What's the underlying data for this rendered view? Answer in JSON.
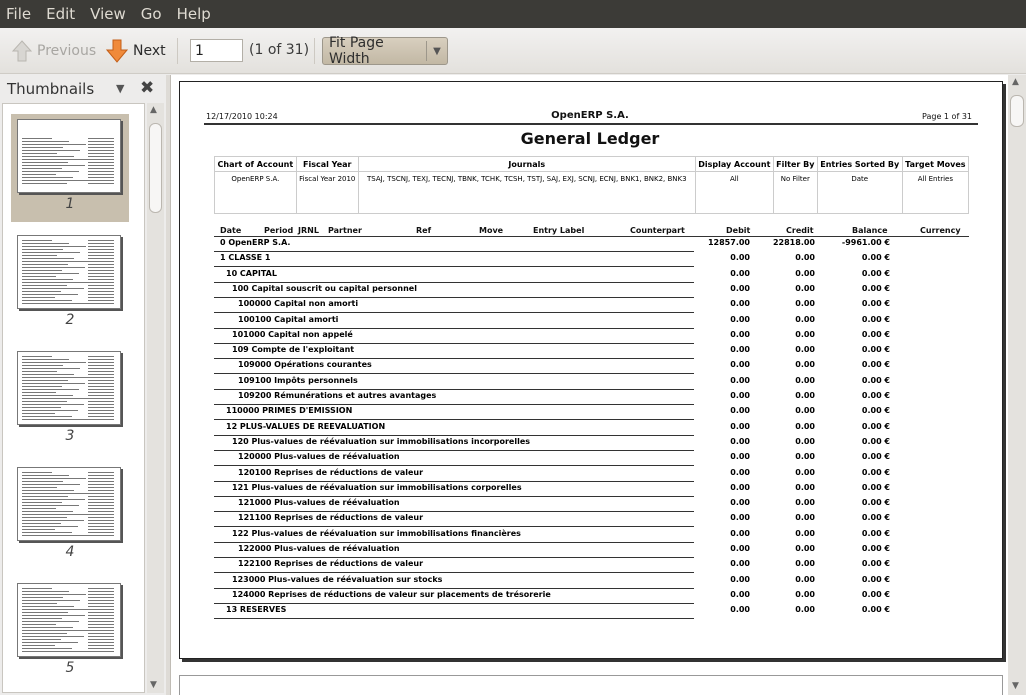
{
  "menu": [
    "File",
    "Edit",
    "View",
    "Go",
    "Help"
  ],
  "toolbar": {
    "previous": "Previous",
    "next": "Next",
    "page_value": "1",
    "page_count": "(1 of 31)",
    "zoom": "Fit Page Width"
  },
  "sidebar": {
    "title": "Thumbnails",
    "thumbnails": [
      "1",
      "2",
      "3",
      "4",
      "5"
    ],
    "selected": "1"
  },
  "report": {
    "date": "12/17/2010  10:24",
    "company": "OpenERP S.A.",
    "page": "Page 1 of 31",
    "title": "General Ledger",
    "filter_headers": [
      "Chart of Account",
      "Fiscal Year",
      "Journals",
      "Display Account",
      "Filter By",
      "Entries Sorted By",
      "Target Moves"
    ],
    "filter_values": [
      "OpenERP S.A.",
      "Fiscal Year 2010",
      "TSAJ, TSCNJ, TEXJ, TECNJ, TBNK, TCHK, TCSH, TSTJ, SAJ, EXJ, SCNJ, ECNJ, BNK1, BNK2, BNK3",
      "All",
      "No Filter",
      "Date",
      "All Entries"
    ],
    "columns": [
      "Date",
      "Period",
      "JRNL",
      "Partner",
      "Ref",
      "Move",
      "Entry Label",
      "Counterpart",
      "Debit",
      "Credit",
      "Balance",
      "Currency"
    ],
    "rows": [
      {
        "label": "0 OpenERP S.A.",
        "indent": 0,
        "debit": "12857.00",
        "credit": "22818.00",
        "balance": "-9961.00 €"
      },
      {
        "label": "1 CLASSE 1",
        "indent": 0,
        "debit": "0.00",
        "credit": "0.00",
        "balance": "0.00 €"
      },
      {
        "label": "10 CAPITAL",
        "indent": 1,
        "debit": "0.00",
        "credit": "0.00",
        "balance": "0.00 €"
      },
      {
        "label": "100 Capital souscrit ou capital personnel",
        "indent": 2,
        "debit": "0.00",
        "credit": "0.00",
        "balance": "0.00 €"
      },
      {
        "label": "100000 Capital non amorti",
        "indent": 3,
        "debit": "0.00",
        "credit": "0.00",
        "balance": "0.00 €"
      },
      {
        "label": "100100 Capital amorti",
        "indent": 3,
        "debit": "0.00",
        "credit": "0.00",
        "balance": "0.00 €"
      },
      {
        "label": "101000 Capital non appelé",
        "indent": 2,
        "debit": "0.00",
        "credit": "0.00",
        "balance": "0.00 €"
      },
      {
        "label": "109 Compte de l'exploitant",
        "indent": 2,
        "debit": "0.00",
        "credit": "0.00",
        "balance": "0.00 €"
      },
      {
        "label": "109000 Opérations courantes",
        "indent": 3,
        "debit": "0.00",
        "credit": "0.00",
        "balance": "0.00 €"
      },
      {
        "label": "109100 Impôts personnels",
        "indent": 3,
        "debit": "0.00",
        "credit": "0.00",
        "balance": "0.00 €"
      },
      {
        "label": "109200 Rémunérations et autres avantages",
        "indent": 3,
        "debit": "0.00",
        "credit": "0.00",
        "balance": "0.00 €"
      },
      {
        "label": "110000 PRIMES D'EMISSION",
        "indent": 1,
        "debit": "0.00",
        "credit": "0.00",
        "balance": "0.00 €"
      },
      {
        "label": "12 PLUS-VALUES DE REEVALUATION",
        "indent": 1,
        "debit": "0.00",
        "credit": "0.00",
        "balance": "0.00 €"
      },
      {
        "label": "120 Plus-values de réévaluation sur immobilisations incorporelles",
        "indent": 2,
        "debit": "0.00",
        "credit": "0.00",
        "balance": "0.00 €"
      },
      {
        "label": "120000 Plus-values de réévaluation",
        "indent": 3,
        "debit": "0.00",
        "credit": "0.00",
        "balance": "0.00 €"
      },
      {
        "label": "120100 Reprises de réductions de valeur",
        "indent": 3,
        "debit": "0.00",
        "credit": "0.00",
        "balance": "0.00 €"
      },
      {
        "label": "121 Plus-values de réévaluation sur immobilisations corporelles",
        "indent": 2,
        "debit": "0.00",
        "credit": "0.00",
        "balance": "0.00 €"
      },
      {
        "label": "121000 Plus-values de réévaluation",
        "indent": 3,
        "debit": "0.00",
        "credit": "0.00",
        "balance": "0.00 €"
      },
      {
        "label": "121100 Reprises de réductions de valeur",
        "indent": 3,
        "debit": "0.00",
        "credit": "0.00",
        "balance": "0.00 €"
      },
      {
        "label": "122 Plus-values de réévaluation sur immobilisations financières",
        "indent": 2,
        "debit": "0.00",
        "credit": "0.00",
        "balance": "0.00 €"
      },
      {
        "label": "122000 Plus-values de réévaluation",
        "indent": 3,
        "debit": "0.00",
        "credit": "0.00",
        "balance": "0.00 €"
      },
      {
        "label": "122100 Reprises de réductions de valeur",
        "indent": 3,
        "debit": "0.00",
        "credit": "0.00",
        "balance": "0.00 €"
      },
      {
        "label": "123000 Plus-values de réévaluation sur stocks",
        "indent": 2,
        "debit": "0.00",
        "credit": "0.00",
        "balance": "0.00 €"
      },
      {
        "label": "124000 Reprises de réductions de valeur sur placements de trésorerie",
        "indent": 2,
        "debit": "0.00",
        "credit": "0.00",
        "balance": "0.00 €"
      },
      {
        "label": "13 RESERVES",
        "indent": 1,
        "debit": "0.00",
        "credit": "0.00",
        "balance": "0.00 €"
      }
    ]
  }
}
